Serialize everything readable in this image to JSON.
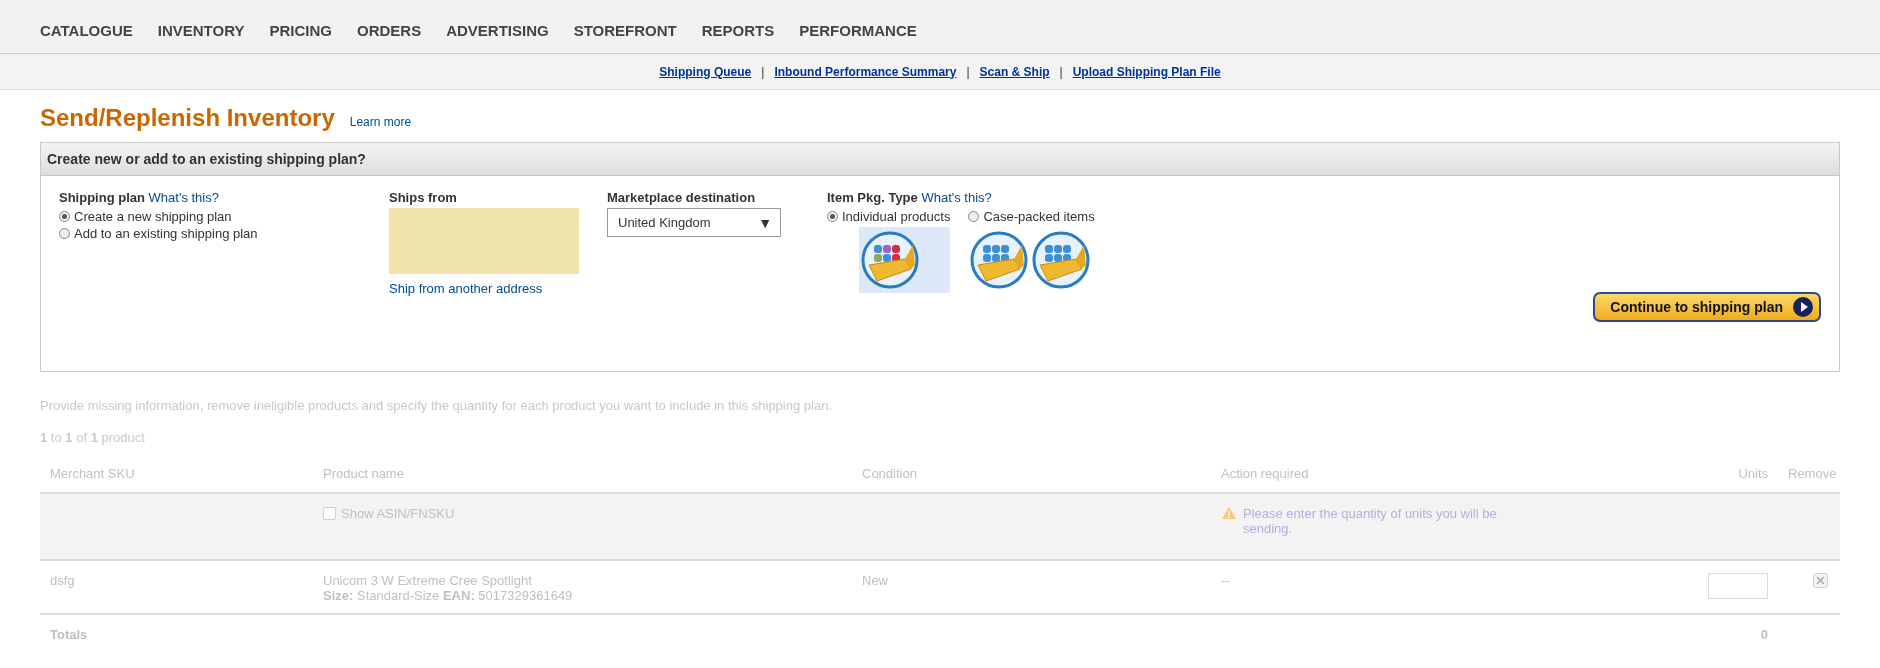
{
  "nav": {
    "tabs": [
      "CATALOGUE",
      "INVENTORY",
      "PRICING",
      "ORDERS",
      "ADVERTISING",
      "STOREFRONT",
      "REPORTS",
      "PERFORMANCE"
    ]
  },
  "subnav": {
    "links": [
      "Shipping Queue",
      "Inbound Performance Summary",
      "Scan & Ship",
      "Upload Shipping Plan File"
    ],
    "separator": "|"
  },
  "page": {
    "title": "Send/Replenish Inventory",
    "learn_more": "Learn more"
  },
  "plan_box": {
    "heading": "Create new or add to an existing shipping plan?",
    "shipping_plan": {
      "label": "Shipping plan",
      "help": "What's this?",
      "options": [
        {
          "label": "Create a new shipping plan",
          "selected": true
        },
        {
          "label": "Add to an existing shipping plan",
          "selected": false
        }
      ]
    },
    "ships_from": {
      "label": "Ships from",
      "link": "Ship from another address"
    },
    "marketplace": {
      "label": "Marketplace destination",
      "value": "United Kingdom",
      "caret": "▼"
    },
    "item_pkg": {
      "label": "Item Pkg. Type",
      "help": "What's this?",
      "options": [
        {
          "label": "Individual products",
          "selected": true,
          "images": [
            {
              "kind": "mixed"
            }
          ]
        },
        {
          "label": "Case-packed items",
          "selected": false,
          "images": [
            {
              "kind": "uniform"
            },
            {
              "kind": "uniform"
            }
          ]
        }
      ]
    },
    "continue_button": "Continue to shipping plan"
  },
  "instructions": "Provide missing information, remove ineligible products and specify the quantity for each product you want to include in this shipping plan.",
  "count": "**1** to **1** of **1** product",
  "table": {
    "columns": [
      "Merchant SKU",
      "Product name",
      "Condition",
      "Action required",
      "Units",
      "Remove"
    ],
    "filter_row": {
      "show_asin": {
        "label": "Show ASIN/FNSKU",
        "checked": false
      },
      "warning": "Please enter the quantity of units you will be sending."
    },
    "rows": [
      {
        "sku": "dsfg",
        "product_name": "Unicom 3 W Extreme Cree Spotlight",
        "details": "**Size:** Standard-Size **EAN:** 5017329361649",
        "condition": "New",
        "action": "--",
        "units": ""
      }
    ],
    "totals": {
      "label": "Totals",
      "units": "0"
    }
  }
}
